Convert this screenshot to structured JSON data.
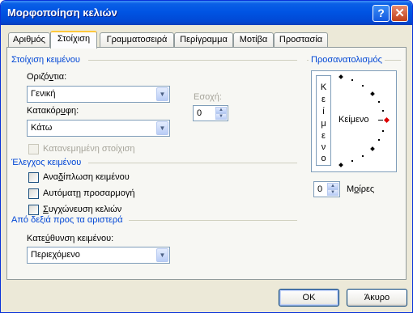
{
  "window": {
    "title": "Μορφοποίηση κελιών",
    "help_icon": "?",
    "close_icon": "✕"
  },
  "tabs": [
    {
      "label": "Αριθμός"
    },
    {
      "label": "Στοίχιση"
    },
    {
      "label": "Γραμματοσειρά"
    },
    {
      "label": "Περίγραμμα"
    },
    {
      "label": "Μοτίβα"
    },
    {
      "label": "Προστασία"
    }
  ],
  "alignment": {
    "group_title": "Στοίχιση κειμένου",
    "horizontal_label_pre": "Οριζό",
    "horizontal_label_ul": "ν",
    "horizontal_label_post": "τια:",
    "horizontal_value": "Γενική",
    "vertical_label_pre": "Κατακόρ",
    "vertical_label_ul": "υ",
    "vertical_label_post": "φη:",
    "vertical_value": "Κάτω",
    "indent_label": "Εσοχή:",
    "indent_value": "0",
    "justify_distributed_label": "Κατανεμημένη στοίχιση"
  },
  "text_control": {
    "group_title": "Έλεγχος κειμένου",
    "wrap_text_label_pre": "Ανα",
    "wrap_text_label_ul": "δ",
    "wrap_text_label_post": "ίπλωση κειμένου",
    "shrink_label_pre": "Αυτόματ",
    "shrink_label_ul": "η",
    "shrink_label_post": " προσαρμογή",
    "merge_label_pre": "",
    "merge_label_ul": "Σ",
    "merge_label_post": "υγχώνευση κελιών"
  },
  "rtl": {
    "group_title": "Από δεξιά προς τα αριστερά",
    "direction_label_pre": "Κατε",
    "direction_label_ul": "ύ",
    "direction_label_post": "θυνση κειμένου:",
    "direction_value": "Περιεχόμενο"
  },
  "orientation": {
    "group_title": "Προσανατολισμός",
    "vertical_text_chars": [
      "Κ",
      "ε",
      "ί",
      "μ",
      "ε",
      "ν",
      "ο"
    ],
    "dial_text": "Κείμενο",
    "degrees_value": "0",
    "degrees_label_pre": "Μ",
    "degrees_label_ul": "ο",
    "degrees_label_post": "ίρες"
  },
  "buttons": {
    "ok_label": "OK",
    "cancel_label": "Άκυρο"
  }
}
